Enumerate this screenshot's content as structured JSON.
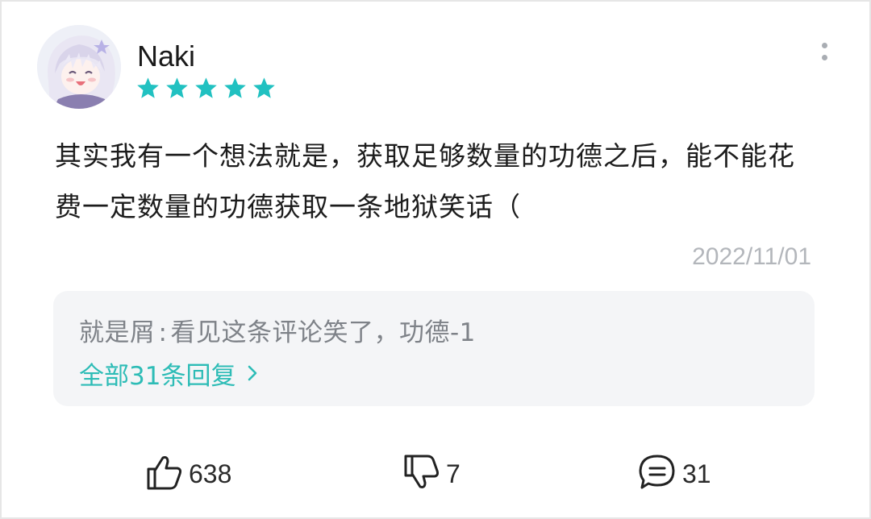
{
  "user": {
    "name": "Naki",
    "rating": 5,
    "star_color": "#21c1c1"
  },
  "comment": {
    "text": "其实我有一个想法就是，获取足够数量的功德之后，能不能花费一定数量的功德获取一条地狱笑话（",
    "date": "2022/11/01"
  },
  "reply_preview": {
    "author": "就是屑",
    "separator": ":",
    "text": "看见这条评论笑了，功德-1",
    "all_replies_label": "全部31条回复",
    "link_color": "#2dbcb6"
  },
  "actions": {
    "like_icon": "thumbs-up-icon",
    "like_count": "638",
    "dislike_icon": "thumbs-down-icon",
    "dislike_count": "7",
    "reply_icon": "comment-bubble-icon",
    "reply_count": "31"
  },
  "menu": {
    "icon": "more-vertical-icon"
  }
}
